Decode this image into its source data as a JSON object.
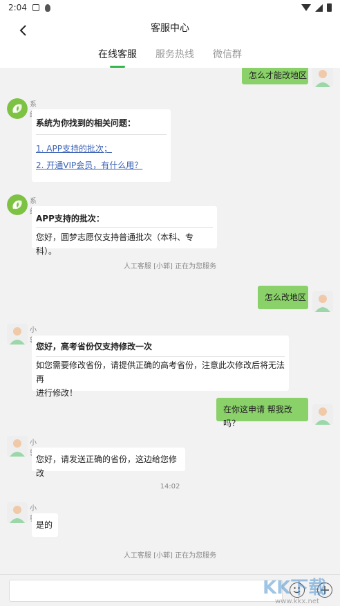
{
  "status_bar": {
    "time": "2:04"
  },
  "header": {
    "title": "客服中心"
  },
  "tabs": [
    {
      "label": "在线客服",
      "active": true
    },
    {
      "label": "服务热线",
      "active": false
    },
    {
      "label": "微信群",
      "active": false
    }
  ],
  "messages": {
    "m1": {
      "text": "怎么才能改地区"
    },
    "m2": {
      "name": "系统",
      "title": "系统为你找到的相关问题：",
      "links": [
        "1. APP支持的批次；",
        "2. 开通VIP会员，有什么用？"
      ]
    },
    "m3": {
      "name": "系统",
      "title": "APP支持的批次：",
      "text": "您好，圆梦志愿仅支持普通批次（本科、专科）。"
    },
    "notice1": "人工客服 [小郭] 正在为您服务",
    "m4": {
      "text": "怎么改地区"
    },
    "m5": {
      "name": "小郭",
      "title": "您好，高考省份仅支持修改一次",
      "text_line1": "如您需要修改省份，请提供正确的高考省份，注意此次修改后将无法再",
      "text_line2": "进行修改！"
    },
    "m6": {
      "text": "在你这申请 帮我改吗？"
    },
    "m7": {
      "name": "小郭",
      "text": "您好，请发送正确的省份，这边给您修改"
    },
    "timestamp": "14:02",
    "m8": {
      "name": "小郭",
      "text": "是的"
    },
    "notice2": "人工客服 [小郭] 正在为您服务"
  },
  "input": {
    "value": "",
    "placeholder": ""
  },
  "watermark": {
    "text": "KK下载",
    "domain": "www.kkx.net"
  },
  "colors": {
    "accent": "#35b64a",
    "bubble_out": "#8ad16a",
    "link": "#3b62b5",
    "background": "#f2f2f2"
  }
}
